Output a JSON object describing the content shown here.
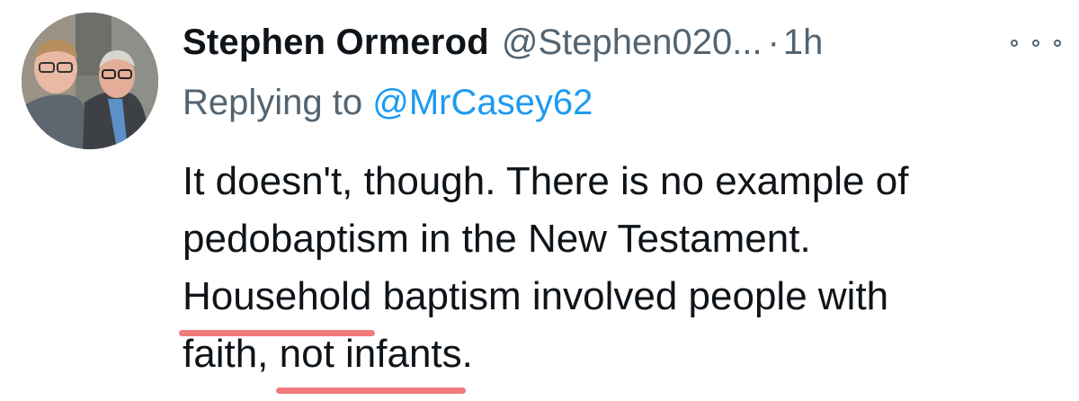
{
  "tweet": {
    "display_name": "Stephen Ormerod",
    "handle": "@Stephen020...",
    "separator": "·",
    "time": "1h",
    "replying_prefix": "Replying to",
    "replying_to": "@MrCasey62",
    "body": {
      "line1": "It doesn't, though. There is no example of",
      "line2": "pedobaptism in the New Testament.",
      "line3_highlight": "Household",
      "line3_rest": " baptism involved people with",
      "line4_prefix": "faith, ",
      "line4_highlight": "not infants",
      "line4_suffix": "."
    }
  },
  "icons": {
    "more": "more-horizontal-icon",
    "avatar": "profile-photo"
  },
  "colors": {
    "primary_text": "#0f1419",
    "secondary_text": "#536471",
    "link": "#1d9bf0",
    "annotation_underline": "#f07b7b"
  }
}
